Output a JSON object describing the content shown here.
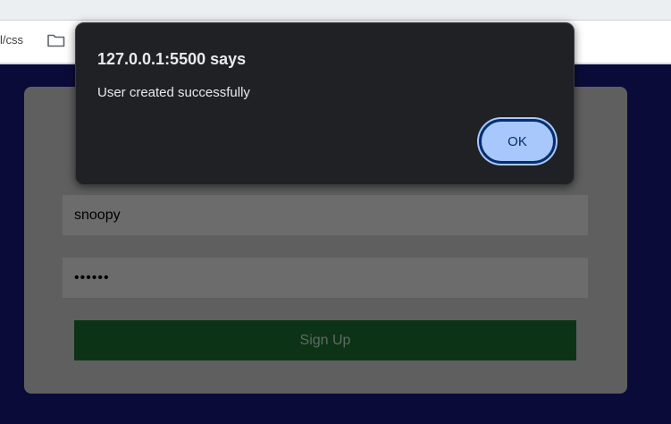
{
  "browser": {
    "bookmark_text": "l/css",
    "icons": {
      "folder": "folder-icon"
    }
  },
  "alert": {
    "title": "127.0.0.1:5500 says",
    "message": "User created successfully",
    "ok_label": "OK"
  },
  "form": {
    "username_value": "snoopy",
    "password_value": "••••••",
    "signup_label": "Sign Up"
  },
  "colors": {
    "page_background": "#0b0b3a",
    "card": "#5f5f5f",
    "dialog_background": "#202124",
    "ok_button": "#a8c7fa",
    "signup_button": "#0d3317"
  }
}
